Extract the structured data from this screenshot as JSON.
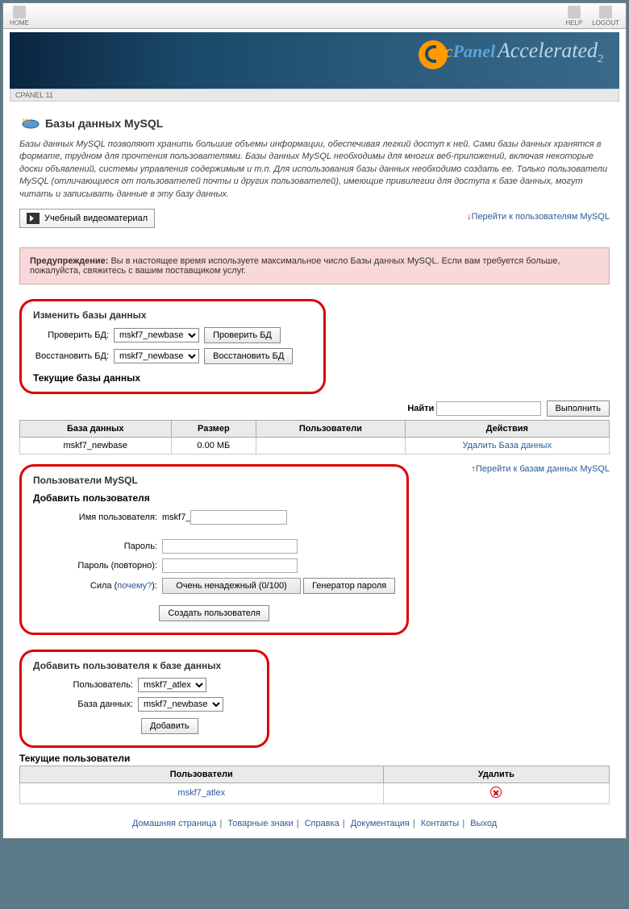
{
  "topbar": {
    "home": "HOME",
    "help": "HELP",
    "logout": "LOGOUT"
  },
  "breadcrumb": "CPANEL 11",
  "banner": {
    "brand_c": "c",
    "brand_panel": "Panel",
    "accel": "Accelerated",
    "sub": "2"
  },
  "page": {
    "title": "Базы данных MySQL",
    "intro": "Базы данных MySQL позволяют хранить большие объемы информации, обеспечивая легкий доступ к ней. Сами базы данных хранятся в формате, трудном для прочтения пользователями. Базы данных MySQL необходимы для многих веб-приложений, включая некоторые доски объявлений, системы управления содержимым и т.п. Для использования базы данных необходимо создать ее. Только пользователи MySQL (отличающиеся от пользователей почты и других пользователей), имеющие привилегии для доступа к базе данных, могут читать и записывать данные в эту базу данных.",
    "tutorial_btn": "Учебный видеоматериал",
    "jump_users": "Перейти к пользователям MySQL",
    "jump_dbs": "Перейти к базам данных MySQL"
  },
  "warning": {
    "label": "Предупреждение:",
    "text": " Вы в настоящее время используете максимальное число Базы данных MySQL. Если вам требуется больше, пожалуйста, свяжитесь с вашим поставщиком услуг."
  },
  "modify_db": {
    "heading": "Изменить базы данных",
    "check_label": "Проверить БД:",
    "check_btn": "Проверить БД",
    "repair_label": "Восстановить БД:",
    "repair_btn": "Восстановить БД",
    "options": [
      "mskf7_newbase"
    ],
    "current_heading": "Текущие базы данных"
  },
  "search": {
    "label": "Найти",
    "btn": "Выполнить"
  },
  "db_table": {
    "headers": [
      "База данных",
      "Размер",
      "Пользователи",
      "Действия"
    ],
    "rows": [
      {
        "name": "mskf7_newbase",
        "size": "0.00 МБ",
        "users": "",
        "action": "Удалить База данных"
      }
    ]
  },
  "users_section": {
    "heading": "Пользователи MySQL",
    "add_heading": "Добавить пользователя",
    "username_label": "Имя пользователя:",
    "username_prefix": "mskf7_",
    "password_label": "Пароль:",
    "password2_label": "Пароль (повторно):",
    "strength_label": "Сила (",
    "why": "почему?",
    "strength_label_end": "):",
    "strength_value": "Очень ненадежный (0/100)",
    "gen_btn": "Генератор пароля",
    "create_btn": "Создать пользователя"
  },
  "add_to_db": {
    "heading": "Добавить пользователя к базе данных",
    "user_label": "Пользователь:",
    "user_options": [
      "mskf7_atlex"
    ],
    "db_label": "База данных:",
    "db_options": [
      "mskf7_newbase"
    ],
    "btn": "Добавить"
  },
  "current_users": {
    "heading": "Текущие пользователи",
    "headers": [
      "Пользователи",
      "Удалить"
    ],
    "rows": [
      {
        "name": "mskf7_atlex"
      }
    ]
  },
  "footer": {
    "items": [
      "Домашняя страница",
      "Товарные знаки",
      "Справка",
      "Документация",
      "Контакты",
      "Выход"
    ]
  }
}
